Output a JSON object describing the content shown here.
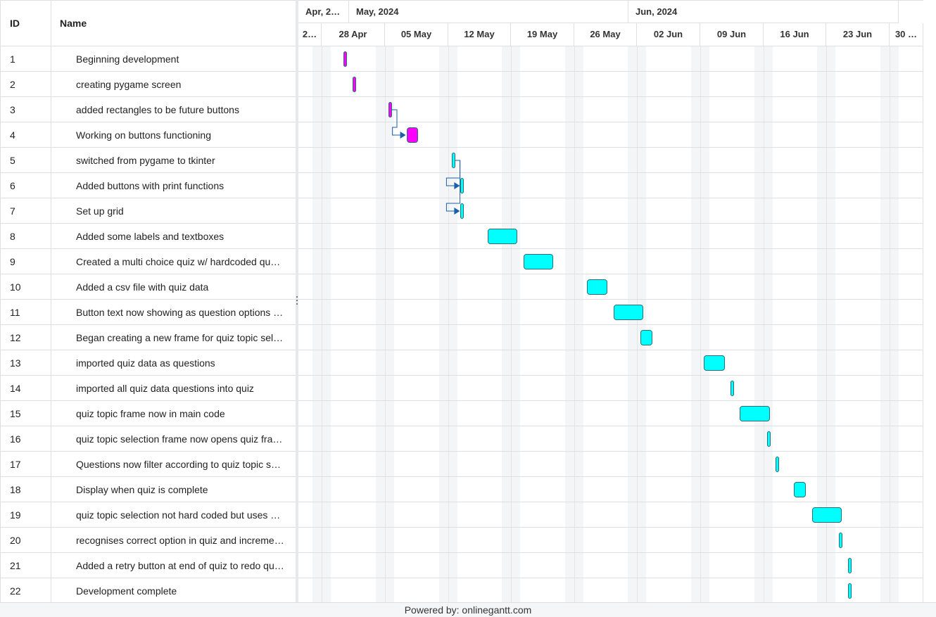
{
  "grid": {
    "header": {
      "id_label": "ID",
      "name_label": "Name"
    },
    "rows": [
      {
        "id": "1",
        "name": "Beginning development"
      },
      {
        "id": "2",
        "name": "creating pygame screen"
      },
      {
        "id": "3",
        "name": "added rectangles to be future buttons"
      },
      {
        "id": "4",
        "name": "Working on buttons functioning"
      },
      {
        "id": "5",
        "name": "switched from pygame to tkinter"
      },
      {
        "id": "6",
        "name": "Added buttons with print functions"
      },
      {
        "id": "7",
        "name": "Set up grid"
      },
      {
        "id": "8",
        "name": "Added some labels and textboxes"
      },
      {
        "id": "9",
        "name": "Created a multi choice quiz w/ hardcoded qu…"
      },
      {
        "id": "10",
        "name": "Added a csv file with quiz data"
      },
      {
        "id": "11",
        "name": "Button text now showing as question options …"
      },
      {
        "id": "12",
        "name": "Began creating a new frame for quiz topic sel…"
      },
      {
        "id": "13",
        "name": "imported quiz data as questions"
      },
      {
        "id": "14",
        "name": "imported all quiz data questions into quiz"
      },
      {
        "id": "15",
        "name": "quiz topic frame now in main code"
      },
      {
        "id": "16",
        "name": "quiz topic selection frame now opens quiz fra…"
      },
      {
        "id": "17",
        "name": "Questions now filter according to quiz topic s…"
      },
      {
        "id": "18",
        "name": "Display when quiz is complete"
      },
      {
        "id": "19",
        "name": "quiz topic selection not hard coded but uses …"
      },
      {
        "id": "20",
        "name": "recognises correct option in quiz and increme…"
      },
      {
        "id": "21",
        "name": "Added a retry button at end of quiz to redo qu…"
      },
      {
        "id": "22",
        "name": "Development complete"
      }
    ]
  },
  "timeline": {
    "months": [
      "Apr, 2…",
      "May, 2024",
      "Jun, 2024"
    ],
    "weeks": [
      "2…",
      "28 Apr",
      "05 May",
      "12 May",
      "19 May",
      "26 May",
      "02 Jun",
      "09 Jun",
      "16 Jun",
      "23 Jun",
      "30 …"
    ],
    "colors": {
      "magenta": "#ff00ff",
      "cyan": "#00ffff",
      "link": "#1a5fa8",
      "bar_border": "#2a6f78"
    },
    "tasks": [
      {
        "start": "2024-04-29",
        "days": 0,
        "color": "magenta"
      },
      {
        "start": "2024-04-30",
        "days": 0,
        "color": "magenta"
      },
      {
        "start": "2024-05-04",
        "days": 0,
        "color": "magenta"
      },
      {
        "start": "2024-05-06",
        "days": 1,
        "color": "magenta"
      },
      {
        "start": "2024-05-11",
        "days": 0,
        "color": "cyan"
      },
      {
        "start": "2024-05-12",
        "days": 0,
        "color": "cyan"
      },
      {
        "start": "2024-05-12",
        "days": 0,
        "color": "cyan"
      },
      {
        "start": "2024-05-15",
        "days": 3,
        "color": "cyan"
      },
      {
        "start": "2024-05-19",
        "days": 3,
        "color": "cyan"
      },
      {
        "start": "2024-05-26",
        "days": 2,
        "color": "cyan"
      },
      {
        "start": "2024-05-29",
        "days": 3,
        "color": "cyan"
      },
      {
        "start": "2024-06-01",
        "days": 1,
        "color": "cyan"
      },
      {
        "start": "2024-06-08",
        "days": 2,
        "color": "cyan"
      },
      {
        "start": "2024-06-11",
        "days": 0,
        "color": "cyan"
      },
      {
        "start": "2024-06-12",
        "days": 3,
        "color": "cyan"
      },
      {
        "start": "2024-06-15",
        "days": 0,
        "color": "cyan"
      },
      {
        "start": "2024-06-16",
        "days": 0,
        "color": "cyan"
      },
      {
        "start": "2024-06-18",
        "days": 1,
        "color": "cyan"
      },
      {
        "start": "2024-06-20",
        "days": 3,
        "color": "cyan"
      },
      {
        "start": "2024-06-23",
        "days": 0,
        "color": "cyan"
      },
      {
        "start": "2024-06-24",
        "days": 0,
        "color": "cyan"
      },
      {
        "start": "2024-06-24",
        "days": 0,
        "color": "cyan"
      }
    ],
    "links": [
      [
        3,
        4
      ],
      [
        5,
        6
      ],
      [
        5,
        7
      ]
    ]
  },
  "footer": {
    "text": "Powered by: onlinegantt.com"
  }
}
